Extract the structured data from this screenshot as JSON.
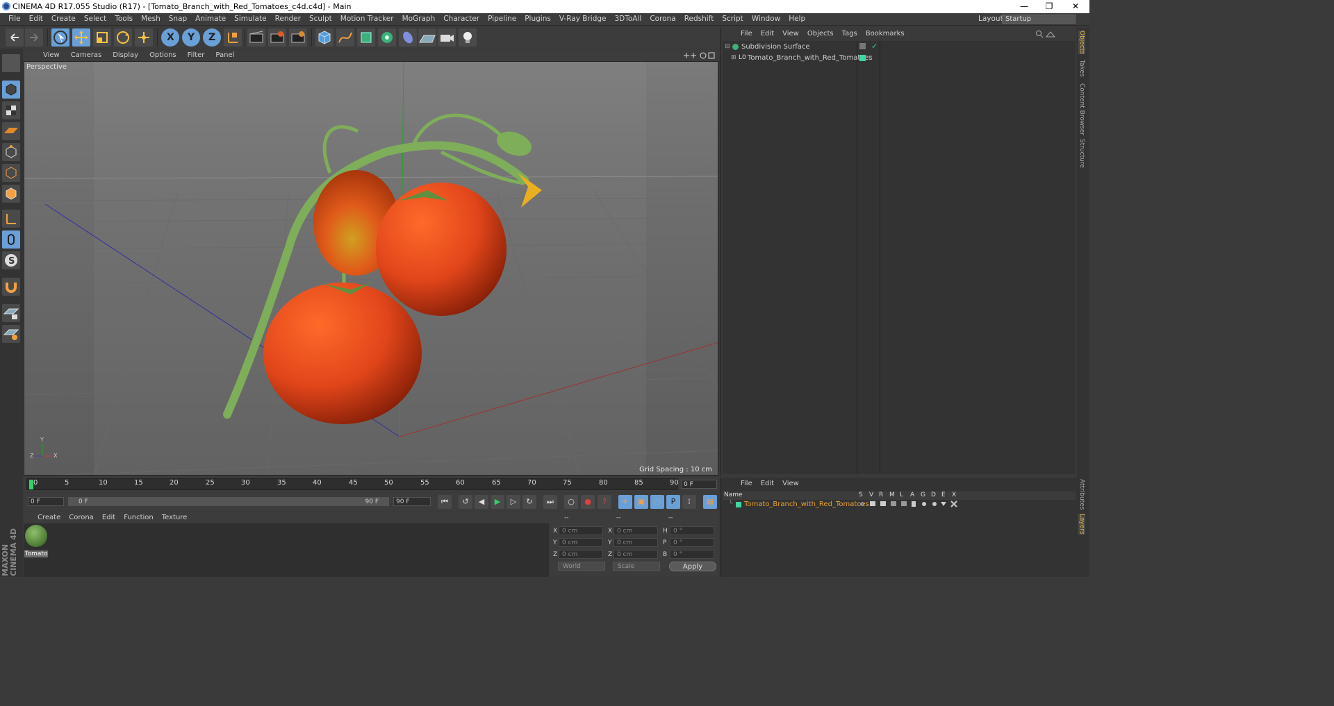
{
  "title": "CINEMA 4D R17.055 Studio (R17) - [Tomato_Branch_with_Red_Tomatoes_c4d.c4d] - Main",
  "window_controls": {
    "minimize": "—",
    "maximize": "❐",
    "close": "✕"
  },
  "main_menu": [
    "File",
    "Edit",
    "Create",
    "Select",
    "Tools",
    "Mesh",
    "Snap",
    "Animate",
    "Simulate",
    "Render",
    "Sculpt",
    "Motion Tracker",
    "MoGraph",
    "Character",
    "Pipeline",
    "Plugins",
    "V-Ray Bridge",
    "3DToAll",
    "Corona",
    "Redshift",
    "Script",
    "Window",
    "Help"
  ],
  "layout": {
    "label": "Layout:",
    "value": "Startup"
  },
  "toolbar": {
    "axis_x": "X",
    "axis_y": "Y",
    "axis_z": "Z"
  },
  "viewport": {
    "menu": [
      "View",
      "Cameras",
      "Display",
      "Options",
      "Filter",
      "Panel"
    ],
    "label": "Perspective",
    "grid_spacing": "Grid Spacing : 10 cm",
    "axis_y": "Y",
    "axis_z": "Z",
    "axis_x": "X"
  },
  "timeline": {
    "ticks": [
      "0",
      "5",
      "10",
      "15",
      "20",
      "25",
      "30",
      "35",
      "40",
      "45",
      "50",
      "55",
      "60",
      "65",
      "70",
      "75",
      "80",
      "85",
      "90"
    ],
    "current_frame": "0 F",
    "start_field": "0 F",
    "range_start": "0 F",
    "range_end": "90 F",
    "end_field": "90 F"
  },
  "material_menu": [
    "Create",
    "Corona",
    "Edit",
    "Function",
    "Texture"
  ],
  "material": {
    "name": "Tomato"
  },
  "coords": {
    "header": [
      "--",
      "--",
      "--"
    ],
    "rows": [
      {
        "l1": "X",
        "v1": "0 cm",
        "l2": "X",
        "v2": "0 cm",
        "l3": "H",
        "v3": "0 °"
      },
      {
        "l1": "Y",
        "v1": "0 cm",
        "l2": "Y",
        "v2": "0 cm",
        "l3": "P",
        "v3": "0 °"
      },
      {
        "l1": "Z",
        "v1": "0 cm",
        "l2": "Z",
        "v2": "0 cm",
        "l3": "B",
        "v3": "0 °"
      }
    ],
    "world": "World",
    "scale": "Scale",
    "apply": "Apply"
  },
  "objects_menu": [
    "File",
    "Edit",
    "View",
    "Objects",
    "Tags",
    "Bookmarks"
  ],
  "objects": [
    {
      "name": "Subdivision Surface"
    },
    {
      "name": "Tomato_Branch_with_Red_Tomatoes"
    }
  ],
  "layers_menu": [
    "File",
    "Edit",
    "View"
  ],
  "layers_header": {
    "name": "Name",
    "cols": [
      "S",
      "V",
      "R",
      "M",
      "L",
      "A",
      "G",
      "D",
      "E",
      "X"
    ]
  },
  "layer_row": {
    "name": "Tomato_Branch_with_Red_Tomatoes"
  },
  "right_tabs": [
    "Objects",
    "Takes",
    "Content Browser",
    "Structure",
    "Attributes",
    "Layers"
  ],
  "branding": "MAXON CINEMA 4D",
  "colors": {
    "accent": "#6aa0d8",
    "tomato": "#e0451a",
    "stem": "#7fae5a",
    "layer_color": "#3fd6a0"
  }
}
